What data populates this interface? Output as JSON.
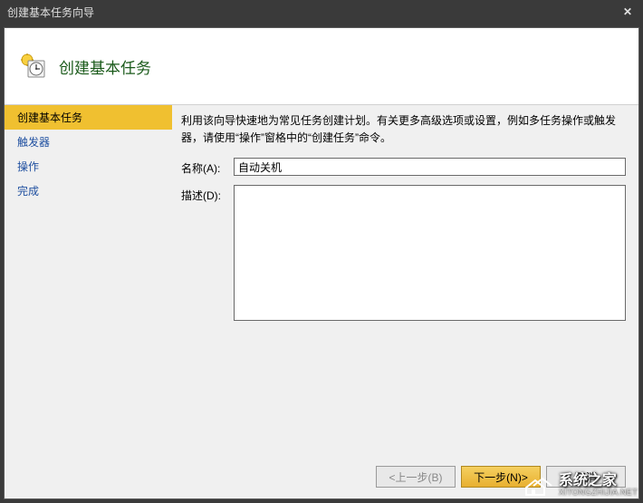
{
  "window": {
    "title": "创建基本任务向导"
  },
  "header": {
    "title": "创建基本任务"
  },
  "sidebar": {
    "items": [
      {
        "label": "创建基本任务",
        "active": true
      },
      {
        "label": "触发器",
        "active": false
      },
      {
        "label": "操作",
        "active": false
      },
      {
        "label": "完成",
        "active": false
      }
    ]
  },
  "content": {
    "instruction": "利用该向导快速地为常见任务创建计划。有关更多高级选项或设置，例如多任务操作或触发器，请使用“操作”窗格中的“创建任务”命令。",
    "name_label": "名称(A):",
    "name_value": "自动关机",
    "desc_label": "描述(D):",
    "desc_value": ""
  },
  "footer": {
    "back_label": "<上一步(B)",
    "next_label": "下一步(N)>",
    "cancel_label": "取消"
  },
  "watermark": {
    "cn": "系统之家",
    "en": "XITONGZHIJIA.NET"
  }
}
